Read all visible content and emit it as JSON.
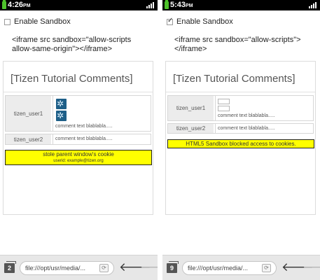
{
  "screens": [
    {
      "status": {
        "time": "4:26",
        "ampm": "PM"
      },
      "sandbox": {
        "label": "Enable Sandbox",
        "checked": false
      },
      "code_line1": "<iframe src sandbox=\"allow-scripts",
      "code_line2": "allow-same-origin\"></iframe>",
      "frame_title": "[Tizen Tutorial Comments]",
      "comments": [
        {
          "user": "tizen_user1",
          "text": "comment text blablabla....."
        },
        {
          "user": "tizen_user2",
          "text": "comment text blablabla....."
        }
      ],
      "banner": {
        "line1": "stole parent window's cookie",
        "line2": "userid: example@tizen.org"
      },
      "toolbar": {
        "tab_count": "2",
        "url": "file:///opt/usr/media/..."
      }
    },
    {
      "status": {
        "time": "5:43",
        "ampm": "PM"
      },
      "sandbox": {
        "label": "Enable Sandbox",
        "checked": true
      },
      "code_line1": "<iframe src sandbox=\"allow-scripts\">",
      "code_line2": "</iframe>",
      "frame_title": "[Tizen Tutorial Comments]",
      "comments": [
        {
          "user": "tizen_user1",
          "text": "comment text blablabla....."
        },
        {
          "user": "tizen_user2",
          "text": "comment text blablabla....."
        }
      ],
      "banner": {
        "line1": "HTML5 Sandbox blocked access to cookies."
      },
      "toolbar": {
        "tab_count": "9",
        "url": "file:///opt/usr/media/..."
      }
    }
  ],
  "colors": {
    "banner": "#ffff00",
    "battery": "#4ec22b",
    "statusbar": "#000000"
  },
  "icons": [
    "battery-icon",
    "signal-icon",
    "checkbox-icon",
    "pinwheel-image-icon",
    "reload-icon",
    "back-arrow-icon",
    "forward-arrow-icon",
    "tabs-icon"
  ]
}
